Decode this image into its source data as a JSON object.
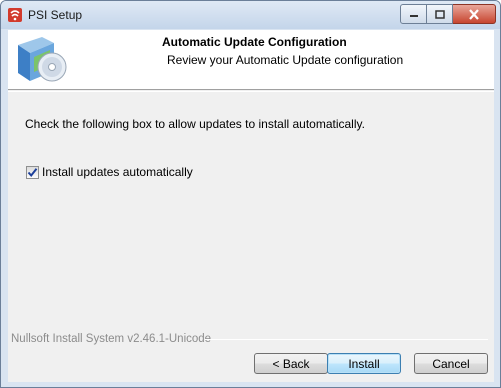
{
  "window": {
    "title": "PSI Setup"
  },
  "header": {
    "title": "Automatic Update Configuration",
    "subtitle": "Review your Automatic Update configuration",
    "icon": "installer-disc-icon"
  },
  "body": {
    "instruction": "Check the following box to allow updates to install automatically.",
    "checkbox": {
      "label": "Install updates automatically",
      "checked": true
    }
  },
  "footer": {
    "branding": "Nullsoft Install System v2.46.1-Unicode",
    "buttons": {
      "back": "< Back",
      "install": "Install",
      "cancel": "Cancel"
    }
  },
  "colors": {
    "title_bar": "#c4d5ea",
    "close_button": "#c7452f",
    "default_button_border": "#3c7fb1"
  }
}
